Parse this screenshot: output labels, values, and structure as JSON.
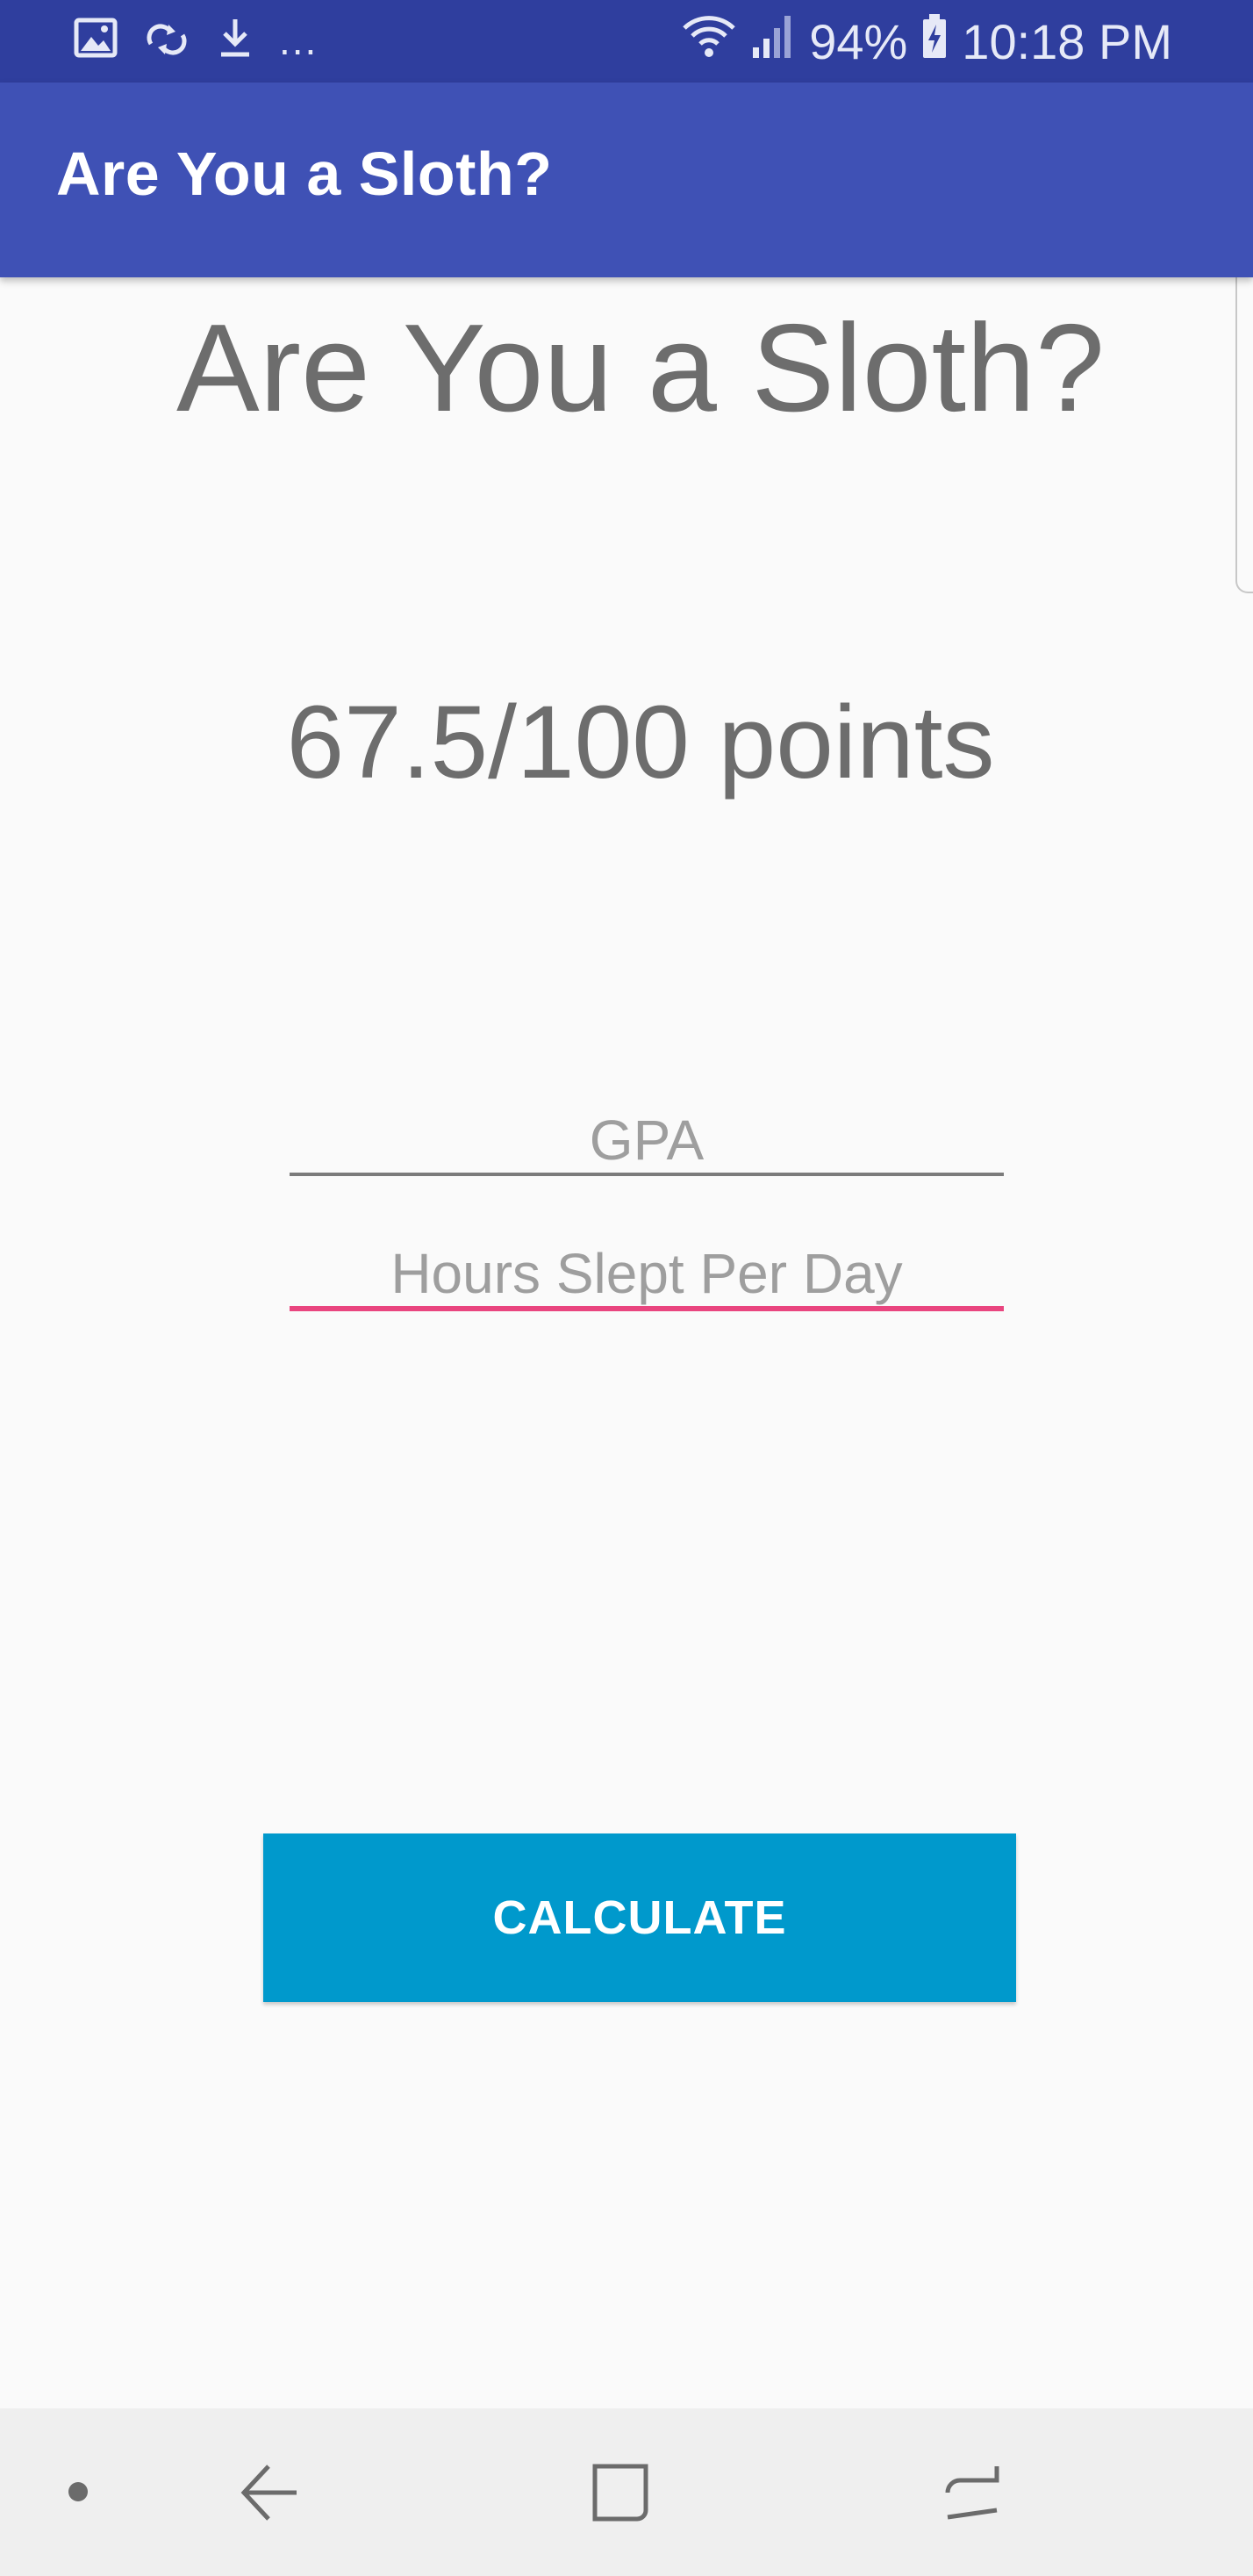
{
  "status_bar": {
    "more_indicator": "...",
    "battery": "94%",
    "time": "10:18 PM",
    "icons": [
      "image-icon",
      "sync-icon",
      "download-icon",
      "wifi-icon",
      "signal-icon",
      "battery-charging-icon"
    ]
  },
  "app_bar": {
    "title": "Are You a Sloth?"
  },
  "main": {
    "heading": "Are You a Sloth?",
    "score": "67.5/100 points",
    "gpa_field": {
      "placeholder": "GPA",
      "value": ""
    },
    "hours_field": {
      "placeholder": "Hours Slept Per Day",
      "value": ""
    },
    "calculate_label": "CALCULATE"
  },
  "nav_bar": {
    "icons": [
      "dot-icon",
      "back-icon",
      "recent-apps-icon",
      "home-icon"
    ]
  },
  "colors": {
    "status_bar": "#2f3e9e",
    "app_bar": "#3f51b5",
    "button": "#0099cc",
    "focused_underline": "#e9457f",
    "text_gray": "#6d6d6d"
  }
}
